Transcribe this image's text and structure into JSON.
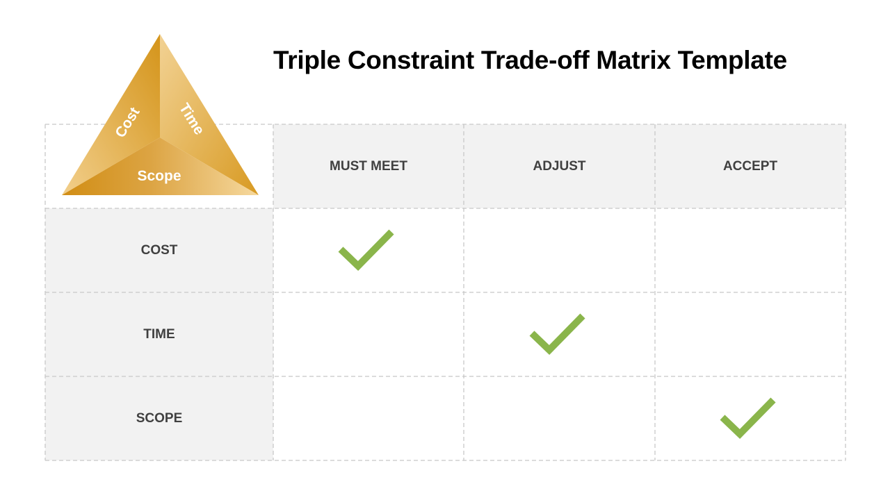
{
  "title": "Triple Constraint Trade-off Matrix Template",
  "triangle": {
    "labels": {
      "cost": "Cost",
      "time": "Time",
      "scope": "Scope"
    },
    "colors": {
      "dark": "#d4941a",
      "light": "#f5d69a"
    }
  },
  "matrix": {
    "columns": [
      "MUST MEET",
      "ADJUST",
      "ACCEPT"
    ],
    "rows": [
      {
        "label": "COST",
        "checked": "MUST MEET"
      },
      {
        "label": "TIME",
        "checked": "ADJUST"
      },
      {
        "label": "SCOPE",
        "checked": "ACCEPT"
      }
    ],
    "check_icon": "checkmark-icon",
    "check_color": "#8ab54b",
    "header_bg": "#f2f2f2",
    "border_color": "#c8c8c8"
  }
}
